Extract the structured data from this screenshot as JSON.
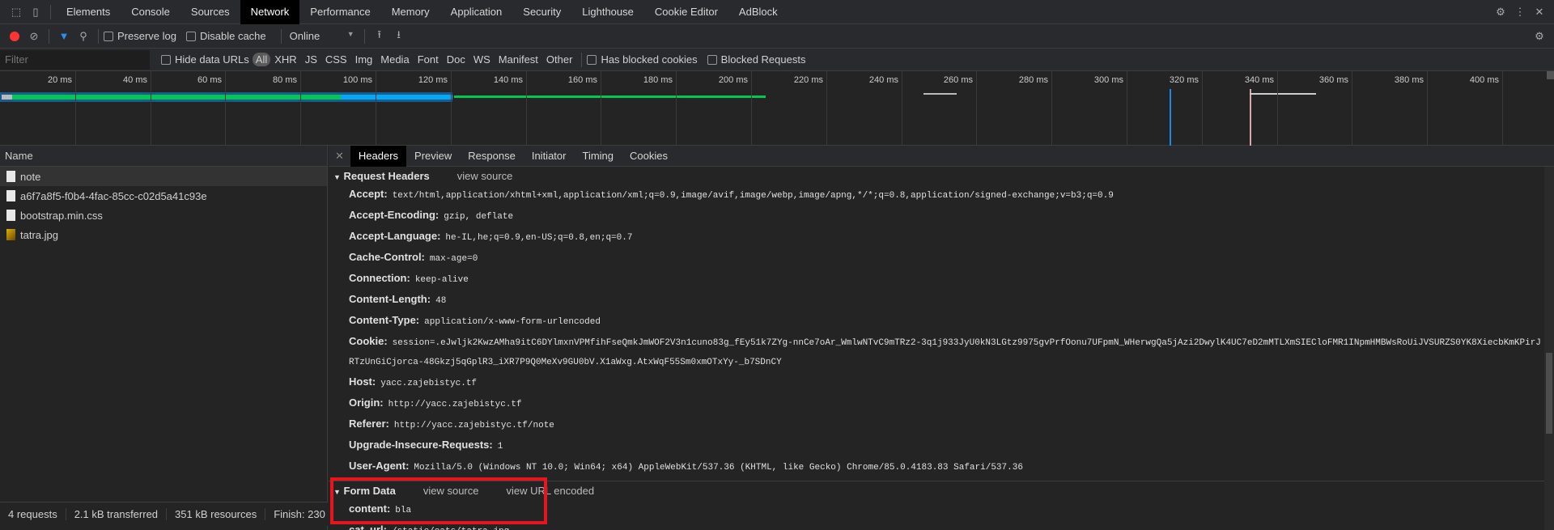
{
  "devtools_tabs": [
    "Elements",
    "Console",
    "Sources",
    "Network",
    "Performance",
    "Memory",
    "Application",
    "Security",
    "Lighthouse",
    "Cookie Editor",
    "AdBlock"
  ],
  "active_tab": "Network",
  "toolbar": {
    "preserve_log": "Preserve log",
    "disable_cache": "Disable cache",
    "throttling": "Online"
  },
  "filter": {
    "placeholder": "Filter",
    "hide_data_urls": "Hide data URLs",
    "types": [
      "All",
      "XHR",
      "JS",
      "CSS",
      "Img",
      "Media",
      "Font",
      "Doc",
      "WS",
      "Manifest",
      "Other"
    ],
    "has_blocked_cookies": "Has blocked cookies",
    "blocked_requests": "Blocked Requests"
  },
  "overview": {
    "ticks": [
      "20 ms",
      "40 ms",
      "60 ms",
      "80 ms",
      "100 ms",
      "120 ms",
      "140 ms",
      "160 ms",
      "180 ms",
      "200 ms",
      "220 ms",
      "240 ms",
      "260 ms",
      "280 ms",
      "300 ms",
      "320 ms",
      "340 ms",
      "360 ms",
      "380 ms",
      "400 ms"
    ],
    "colors": {
      "waiting": "#00c853",
      "download": "#03a9f4",
      "selected": "#1a5a8c"
    }
  },
  "requests": {
    "header": "Name",
    "items": [
      {
        "name": "note",
        "type": "doc"
      },
      {
        "name": "a6f7a8f5-f0b4-4fac-85cc-c02d5a41c93e",
        "type": "doc"
      },
      {
        "name": "bootstrap.min.css",
        "type": "doc"
      },
      {
        "name": "tatra.jpg",
        "type": "img"
      }
    ]
  },
  "status": {
    "requests": "4 requests",
    "transferred": "2.1 kB transferred",
    "resources": "351 kB resources",
    "finish": "Finish: 230"
  },
  "detail_tabs": [
    "Headers",
    "Preview",
    "Response",
    "Initiator",
    "Timing",
    "Cookies"
  ],
  "request_headers": {
    "title": "Request Headers",
    "view_source": "view source",
    "items": [
      {
        "name": "Accept:",
        "value": "text/html,application/xhtml+xml,application/xml;q=0.9,image/avif,image/webp,image/apng,*/*;q=0.8,application/signed-exchange;v=b3;q=0.9"
      },
      {
        "name": "Accept-Encoding:",
        "value": "gzip, deflate"
      },
      {
        "name": "Accept-Language:",
        "value": "he-IL,he;q=0.9,en-US;q=0.8,en;q=0.7"
      },
      {
        "name": "Cache-Control:",
        "value": "max-age=0"
      },
      {
        "name": "Connection:",
        "value": "keep-alive"
      },
      {
        "name": "Content-Length:",
        "value": "48"
      },
      {
        "name": "Content-Type:",
        "value": "application/x-www-form-urlencoded"
      },
      {
        "name": "Cookie:",
        "value": "session=.eJwljk2KwzAMha9itC6DYlmxnVPMfihFseQmkJmWOF2V3n1cuno83g_fEy51k7ZYg-nnCe7oAr_WmlwNTvC9mTRz2-3q1j933JyU0kN3LGtz9975gvPrfOonu7UFpmN_WHerwgQa5jAzi2DwylK4UC7eD2mMTLXmSIECloFMR1INpmHMBWsRoUiJVSURZS0YK8XiecbKmKPirJRTzUnGiCjorca-48Gkzj5qGplR3_iXR7P9Q0MeXv9GU0bV.X1aWxg.AtxWqF55Sm0xmOTxYy-_b7SDnCY"
      },
      {
        "name": "Host:",
        "value": "yacc.zajebistyc.tf"
      },
      {
        "name": "Origin:",
        "value": "http://yacc.zajebistyc.tf"
      },
      {
        "name": "Referer:",
        "value": "http://yacc.zajebistyc.tf/note"
      },
      {
        "name": "Upgrade-Insecure-Requests:",
        "value": "1"
      },
      {
        "name": "User-Agent:",
        "value": "Mozilla/5.0 (Windows NT 10.0; Win64; x64) AppleWebKit/537.36 (KHTML, like Gecko) Chrome/85.0.4183.83 Safari/537.36"
      }
    ]
  },
  "form_data": {
    "title": "Form Data",
    "view_source": "view source",
    "view_url_encoded": "view URL encoded",
    "items": [
      {
        "name": "content:",
        "value": "bla"
      },
      {
        "name": "cat_url:",
        "value": "/static/cats/tatra.jpg"
      }
    ]
  },
  "highlight_color": "#e8141e"
}
